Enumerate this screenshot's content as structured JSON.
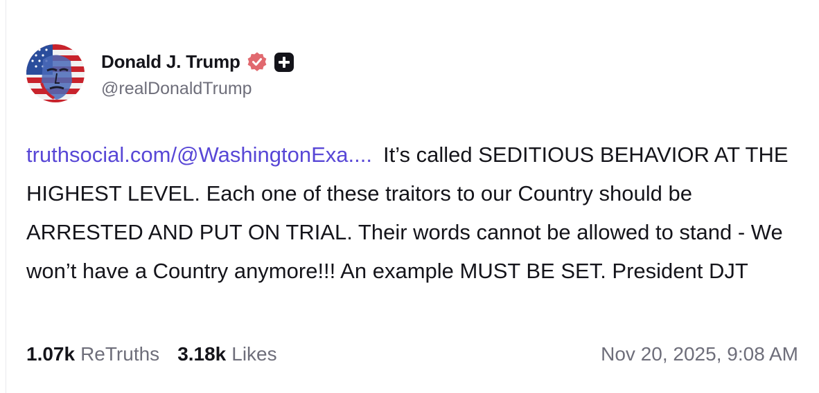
{
  "post": {
    "author": {
      "display_name": "Donald J. Trump",
      "handle": "@realDonaldTrump",
      "verified": true,
      "verified_color": "#e1696f",
      "badge_icon": "plus-square-icon"
    },
    "link_text": "truthsocial.com/@WashingtonExa....",
    "link_color": "#5847d6",
    "text": "It’s called SEDITIOUS BEHAVIOR AT THE HIGHEST LEVEL. Each one of these traitors to our Country should be ARRESTED AND PUT ON TRIAL. Their words cannot be allowed to stand - We won’t have a Country anymore!!! An example MUST BE SET. President DJT",
    "stats": {
      "retruths_count": "1.07k",
      "retruths_label": "ReTruths",
      "likes_count": "3.18k",
      "likes_label": "Likes"
    },
    "timestamp": "Nov 20, 2025, 9:08 AM"
  }
}
